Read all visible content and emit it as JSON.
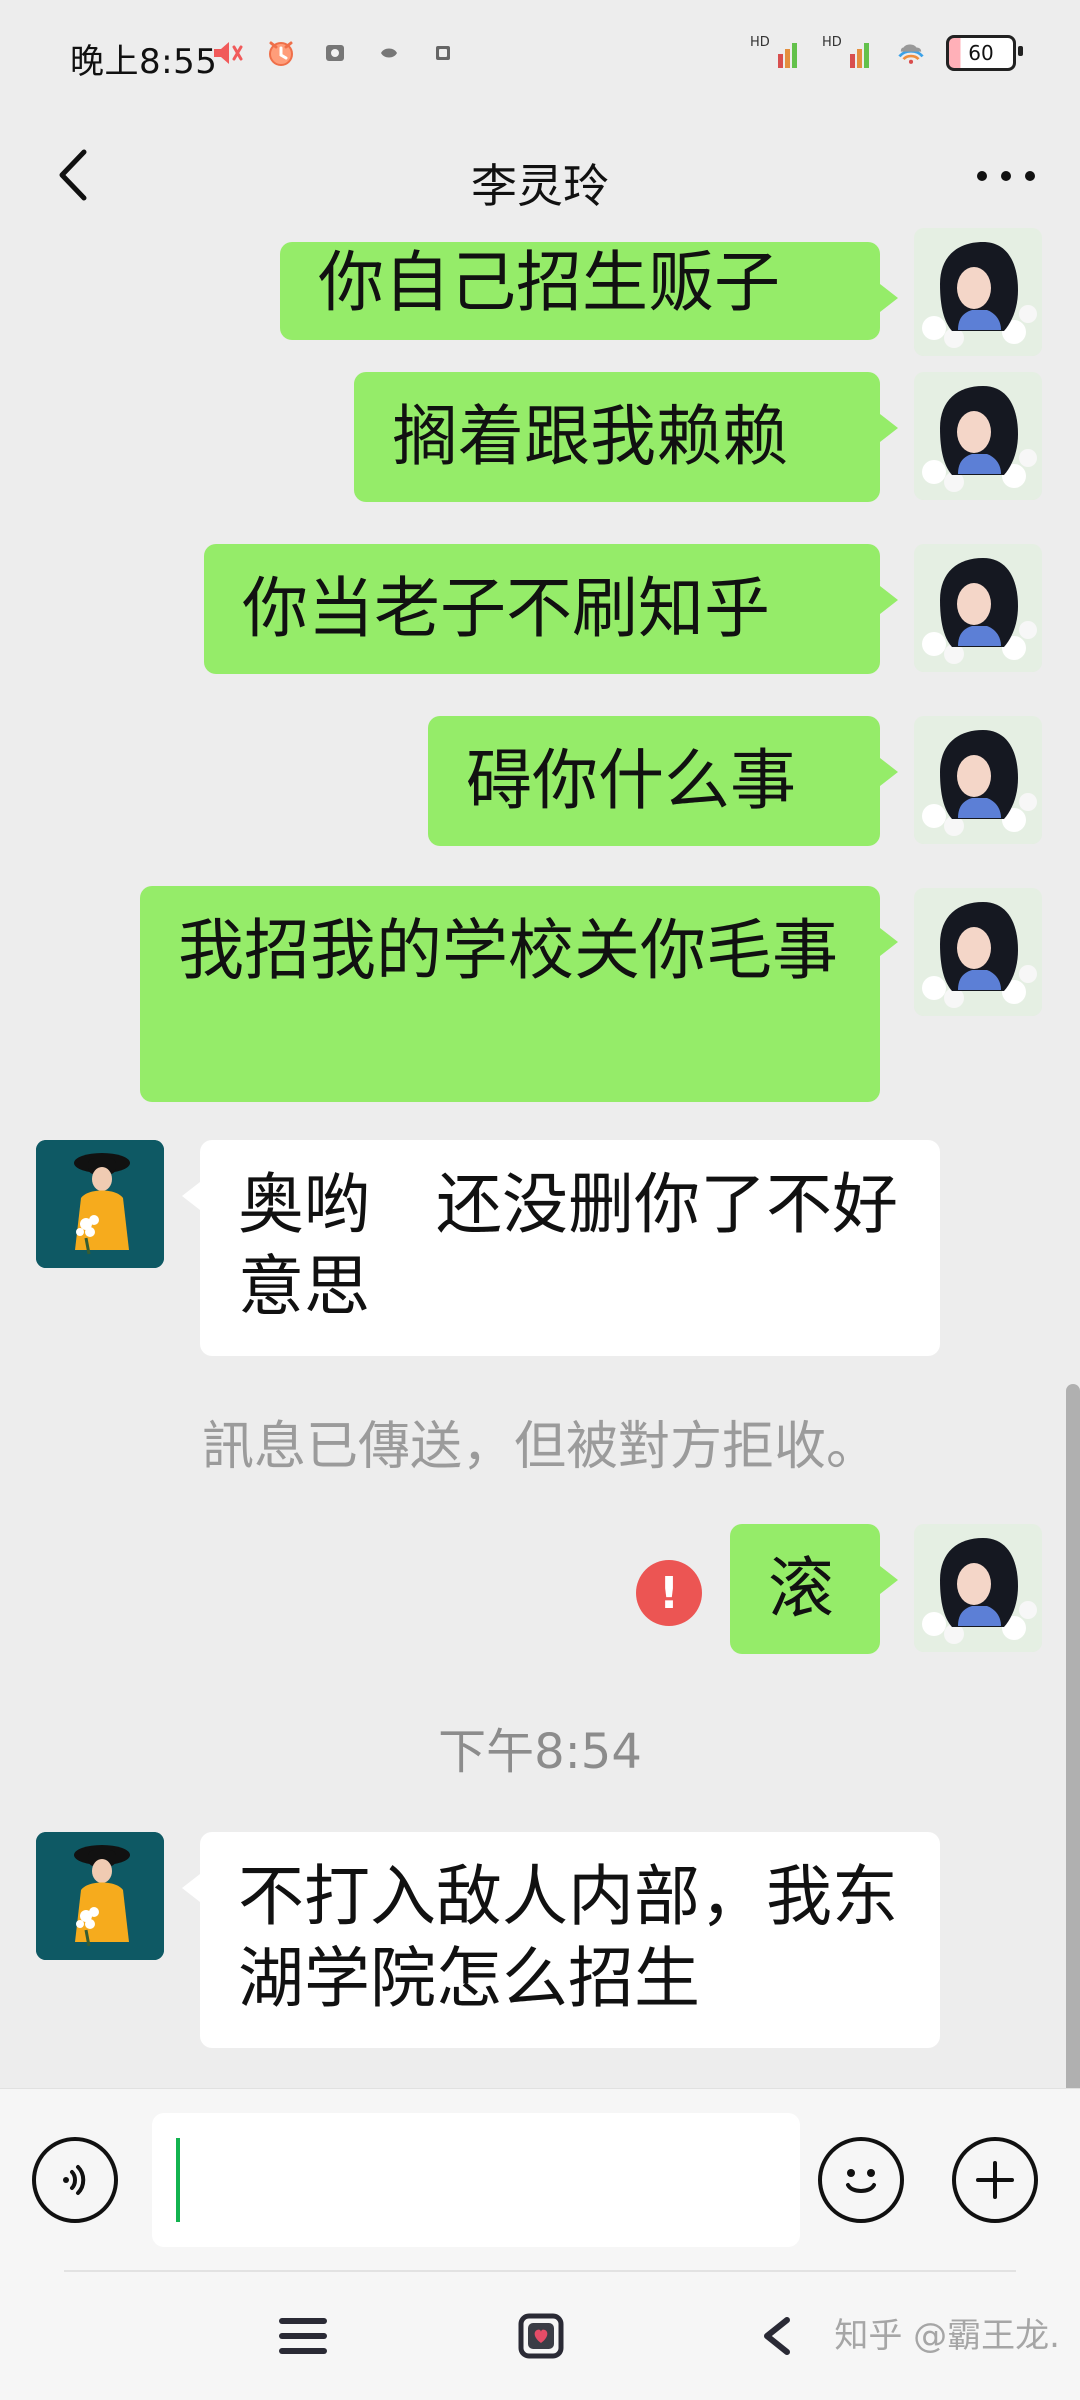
{
  "status_bar": {
    "time": "晚上8:55",
    "battery_level": "60",
    "network_1": "HD",
    "network_2": "HD"
  },
  "header": {
    "title": "李灵玲"
  },
  "messages": {
    "m1": "你自己招生贩子",
    "m2": "搁着跟我赖赖",
    "m3": "你当老子不刷知乎",
    "m4": "碍你什么事",
    "m5": "我招我的学校关你毛事",
    "m6": "奥哟　还没删你了不好意思",
    "system_note": "訊息已傳送，但被對方拒收。",
    "m7": "滚",
    "time_note": "下午8:54",
    "m8": "不打入敌人内部，我东湖学院怎么招生"
  },
  "watermark": {
    "text": "知乎 @霸王龙."
  },
  "icons": {
    "back": "back-icon",
    "more": "more-icon",
    "voice": "voice-icon",
    "emoji": "emoji-icon",
    "plus": "plus-icon",
    "menu": "menu-icon",
    "home": "home-icon",
    "nav_back": "nav-back-icon",
    "error": "error-icon"
  },
  "colors": {
    "self_bubble": "#95ec69",
    "other_bubble": "#ffffff",
    "chat_background": "#ededed",
    "error": "#ec5553"
  }
}
